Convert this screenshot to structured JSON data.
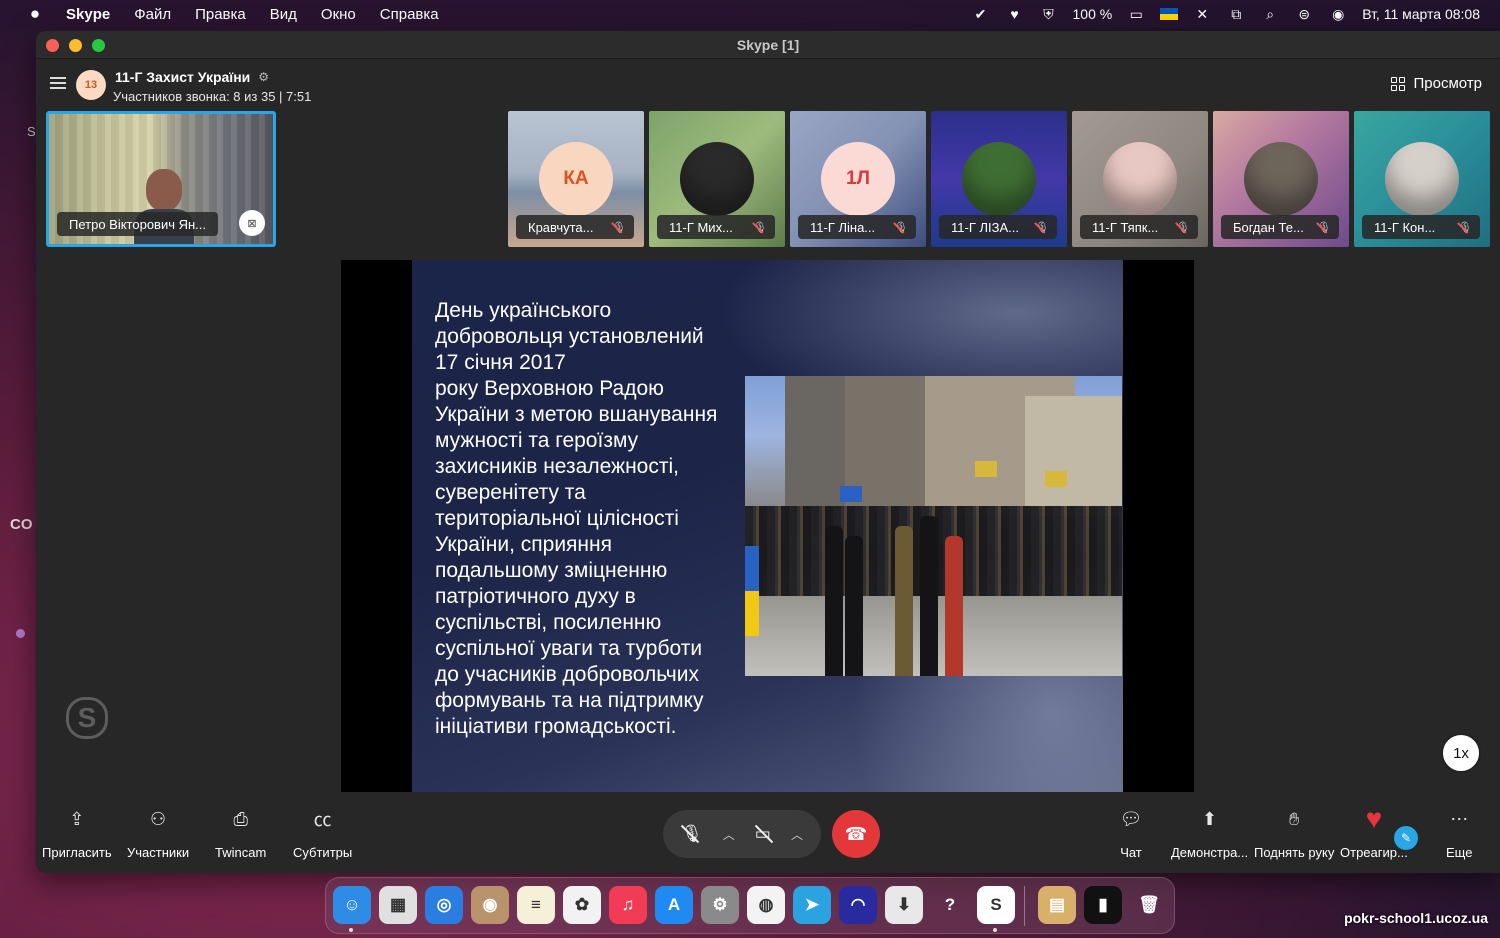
{
  "menubar": {
    "app_name": "Skype",
    "items": [
      "Файл",
      "Правка",
      "Вид",
      "Окно",
      "Справка"
    ],
    "battery": "100 %",
    "datetime": "Вт, 11 марта  08:08"
  },
  "desktop": {
    "partial_s": "S",
    "partial_co": "CO"
  },
  "window": {
    "title": "Skype [1]"
  },
  "call": {
    "group_badge": "13",
    "group_name": "11-Г Захист України",
    "info": "Участников звонка: 8 из 35 | 7:51",
    "view_label": "Просмотр"
  },
  "self_tile": {
    "name": "Петро Вікторович Ян..."
  },
  "participants": [
    {
      "initials": "КА",
      "name": "Кравчута...",
      "avatar_type": "initials",
      "bg": "#f9d6c0",
      "fg": "#d9541e",
      "tile_bg": "linear-gradient(180deg,#b8c4d2 0%,#a7b3c3 45%,#7d8ea5 60%,#c8a88e 100%)"
    },
    {
      "initials": "",
      "name": "11-Г Мих...",
      "avatar_type": "photo",
      "bg": "#2a2a2a",
      "fg": "#fff",
      "tile_bg": "linear-gradient(135deg,#7da36a 0%,#9dbb7c 50%,#5e7c4a 100%)"
    },
    {
      "initials": "1Л",
      "name": "11-Г Ліна...",
      "avatar_type": "initials",
      "bg": "#fbd9d5",
      "fg": "#d93a3a",
      "tile_bg": "linear-gradient(135deg,#9aa6c4 0%,#8391b3 50%,#3d4d80 100%)"
    },
    {
      "initials": "",
      "name": "11-Г ЛІЗА...",
      "avatar_type": "photo",
      "bg": "#3f6e34",
      "fg": "#fff",
      "tile_bg": "linear-gradient(180deg,#2b2f8a 0%,#4338a8 50%,#1d3a8c 100%)"
    },
    {
      "initials": "",
      "name": "11-Г Тяпк...",
      "avatar_type": "photo",
      "bg": "#e8c8c2",
      "fg": "#fff",
      "tile_bg": "linear-gradient(135deg,#a49a93 0%,#8e867f 60%,#6b6560 100%)"
    },
    {
      "initials": "",
      "name": "Богдан Те...",
      "avatar_type": "photo",
      "bg": "#6d645a",
      "fg": "#fff",
      "tile_bg": "linear-gradient(135deg,#d9a9a0 0%,#b57aa0 40%,#6e4a8c 100%)"
    },
    {
      "initials": "",
      "name": "11-Г Кон...",
      "avatar_type": "photo",
      "bg": "#d6d0ca",
      "fg": "#fff",
      "tile_bg": "linear-gradient(135deg,#3aa6a0 0%,#2a8e9a 50%,#1f6f80 100%)"
    }
  ],
  "slide": {
    "text": "День українського\nдобровольця установлений\n17 січня 2017\nроку Верховною Радою\nУкраїни з метою вшанування\nмужності та героїзму\nзахисників незалежності,\nсуверенітету та\nтериторіальної цілісності\nУкраїни, сприяння\nподальшому зміцненню\nпатріотичного духу в\nсуспільстві, посиленню\nсуспільної уваги та турботи\nдо учасників добровольчих\nформувань та на підтримку\nініціативи громадськості."
  },
  "speed": "1x",
  "toolbar": {
    "invite": "Пригласить",
    "participants": "Участники",
    "twincam": "Twincam",
    "subtitles": "Субтитры",
    "chat": "Чат",
    "share": "Демонстра...",
    "raise_hand": "Поднять руку",
    "react": "Отреагир...",
    "more": "Еще"
  },
  "dock": {
    "apps": [
      {
        "name": "finder",
        "glyph": "☺",
        "color": "#2e8ce6"
      },
      {
        "name": "launchpad",
        "glyph": "▦",
        "color": "#e0e0e0"
      },
      {
        "name": "safari",
        "glyph": "◎",
        "color": "#2a7de1"
      },
      {
        "name": "contacts",
        "glyph": "◉",
        "color": "#b9936b"
      },
      {
        "name": "notes",
        "glyph": "≡",
        "color": "#f5f0d8"
      },
      {
        "name": "photos",
        "glyph": "✿",
        "color": "#f2f2f2"
      },
      {
        "name": "music",
        "glyph": "♫",
        "color": "#f23b55"
      },
      {
        "name": "app-store",
        "glyph": "A",
        "color": "#1f8bf2"
      },
      {
        "name": "settings",
        "glyph": "⚙",
        "color": "#8a8a8a"
      },
      {
        "name": "chrome",
        "glyph": "◍",
        "color": "#f3f3f3"
      },
      {
        "name": "telegram",
        "glyph": "➤",
        "color": "#2aa3e0"
      },
      {
        "name": "podcast-app",
        "glyph": "◠",
        "color": "#2a2aa0"
      },
      {
        "name": "installer",
        "glyph": "⬇",
        "color": "#e8e8e8"
      },
      {
        "name": "help",
        "glyph": "?",
        "color": "transparent"
      },
      {
        "name": "skype",
        "glyph": "S",
        "color": "#ffffff"
      }
    ],
    "right_apps": [
      {
        "name": "archive",
        "glyph": "▤",
        "color": "#d9b06a"
      },
      {
        "name": "terminal-app",
        "glyph": "▮",
        "color": "#111111"
      },
      {
        "name": "trash",
        "glyph": "🗑",
        "color": "transparent"
      }
    ]
  },
  "watermark": "pokr-school1.ucoz.ua",
  "colors": {
    "accent": "#29a6e6",
    "hangup": "#e3373a",
    "heart": "#e8343c"
  }
}
